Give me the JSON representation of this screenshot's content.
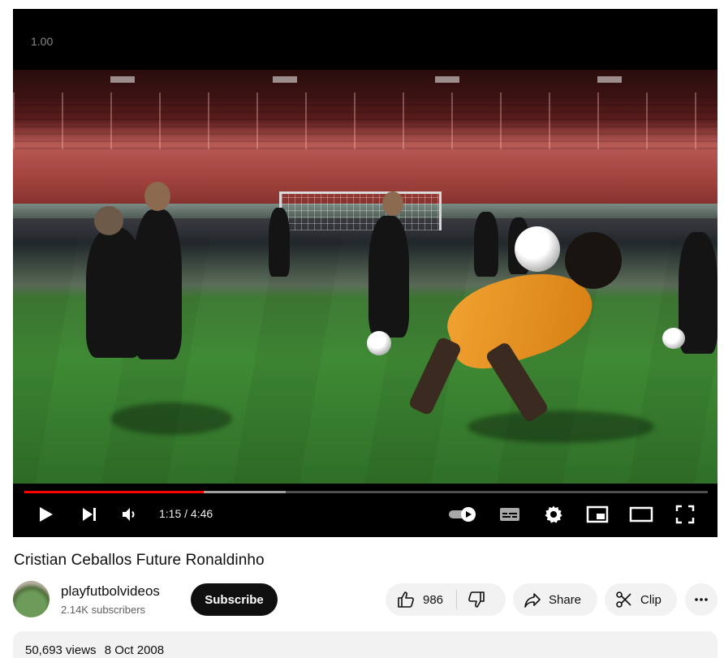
{
  "player": {
    "speed_overlay": "1.00",
    "current_time": "1:15",
    "duration": "4:46",
    "progress_fraction": 0.262,
    "buffered_fraction": 0.382
  },
  "video": {
    "title": "Cristian Ceballos Future Ronaldinho",
    "views": "50,693 views",
    "date": "8 Oct 2008"
  },
  "channel": {
    "name": "playfutbolvideos",
    "subscribers": "2.14K subscribers",
    "subscribe_label": "Subscribe"
  },
  "actions": {
    "like_count": "986",
    "share_label": "Share",
    "clip_label": "Clip"
  },
  "colors": {
    "progress_played": "#ff0000",
    "button_bg": "#f2f2f2",
    "subscribe_bg": "#0f0f0f"
  },
  "icons": [
    "play-icon",
    "next-icon",
    "volume-icon",
    "autoplay-toggle-icon",
    "subtitles-icon",
    "settings-icon",
    "miniplayer-icon",
    "theater-mode-icon",
    "fullscreen-icon",
    "thumbs-up-icon",
    "thumbs-down-icon",
    "share-icon",
    "scissors-icon",
    "more-icon"
  ]
}
